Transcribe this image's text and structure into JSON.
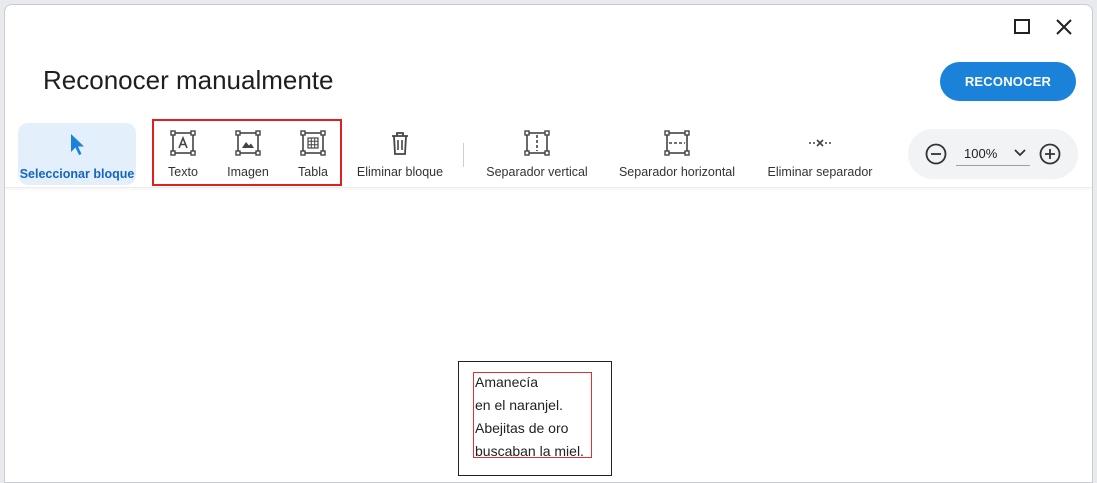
{
  "window": {
    "maximize_icon": "maximize-icon",
    "close_icon": "close-icon"
  },
  "header": {
    "title": "Reconocer manualmente",
    "primary_button": "RECONOCER"
  },
  "toolbar": {
    "select_block": "Seleccionar bloque",
    "text": "Texto",
    "image": "Imagen",
    "table": "Tabla",
    "delete_block": "Eliminar bloque",
    "vertical_separator": "Separador vertical",
    "horizontal_separator": "Separador horizontal",
    "delete_separator": "Eliminar separador"
  },
  "zoom": {
    "value": "100%"
  },
  "document": {
    "lines": [
      "Amanecía",
      "en el naranjel.",
      "Abejitas de oro",
      "buscaban la miel."
    ]
  },
  "colors": {
    "accent": "#1a82d8",
    "highlight": "#e0201f",
    "active_bg": "#e3f0fc"
  }
}
